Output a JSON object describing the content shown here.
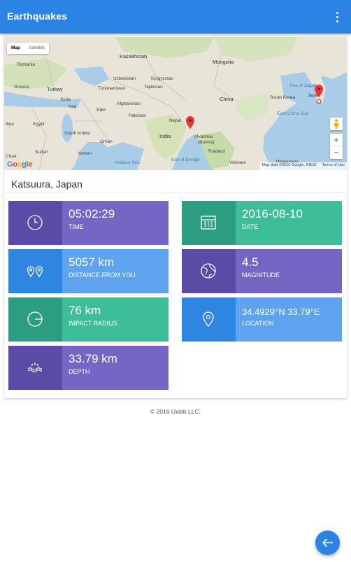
{
  "appbar": {
    "title": "Earthquakes"
  },
  "map": {
    "type_map": "Map",
    "type_satellite": "Satellite",
    "zoom_in": "+",
    "zoom_out": "−",
    "attribution": "Map data ©2016 Google, INEGI",
    "terms": "Terms of Use",
    "logo": "Google",
    "labels": {
      "romania": "Romania",
      "kazakhstan": "Kazakhstan",
      "mongolia": "Mongolia",
      "greece": "Greece",
      "turkey": "Turkey",
      "uzbekistan": "Uzbekistan",
      "kyrgyzstan": "Kyrgyzstan",
      "turkmenistan": "Turkmenistan",
      "tajikistan": "Tajikistan",
      "sea_of_japan": "Sea of Japan",
      "japan": "Japa",
      "syria": "Syria",
      "iraq": "Iraq",
      "iran": "Iran",
      "afghanistan": "Afghanistan",
      "china": "China",
      "south_korea": "South Korea",
      "libya": "ibya",
      "egypt": "Egypt",
      "saudi_arabia": "Saudi Arabia",
      "pakistan": "Pakistan",
      "nepal": "Nepal",
      "east_china_sea": "East China Sea",
      "india": "India",
      "myanmar": "Myanmar",
      "burma": "(Burma)",
      "oman": "Oman",
      "chad": "Chad",
      "sudan": "Sudan",
      "yemen": "Yemen",
      "thailand": "Thailand",
      "bay_of_bengal": "Bay of Bengal",
      "arabian_sea": "Arabian Sea",
      "vietnam": "Vietnam",
      "philippines": "Philippines"
    }
  },
  "location_title": "Katsuura, Japan",
  "tiles": {
    "time": {
      "value": "05:02:29",
      "label": "TIME"
    },
    "date": {
      "value": "2016-08-10",
      "label": "DATE"
    },
    "distance": {
      "value": "5057 km",
      "label": "DISTANCE FROM YOU"
    },
    "magnitude": {
      "value": "4.5",
      "label": "MAGNITUDE"
    },
    "radius": {
      "value": "76 km",
      "label": "IMPACT RADIUS"
    },
    "location": {
      "value": "34.4929°N 33.79°E",
      "label": "LOCATION"
    },
    "depth": {
      "value": "33.79 km",
      "label": "DEPTH"
    }
  },
  "footer": "© 2016 Uxlab LLC.",
  "colors": {
    "primary": "#2c83e6",
    "purple_dark": "#5a4ca6",
    "purple_light": "#7466c2",
    "teal_dark": "#2c9e7f",
    "teal_light": "#3dbe98",
    "blue_dark": "#2f85e2",
    "blue_light": "#5da3ef"
  },
  "icons": {
    "more": "more-vert-icon",
    "time": "clock-icon",
    "date": "calendar-icon",
    "distance": "two-pins-icon",
    "magnitude": "globe-icon",
    "radius": "radius-icon",
    "location": "pin-icon",
    "depth": "waves-icon",
    "fab": "arrow-back-icon"
  }
}
